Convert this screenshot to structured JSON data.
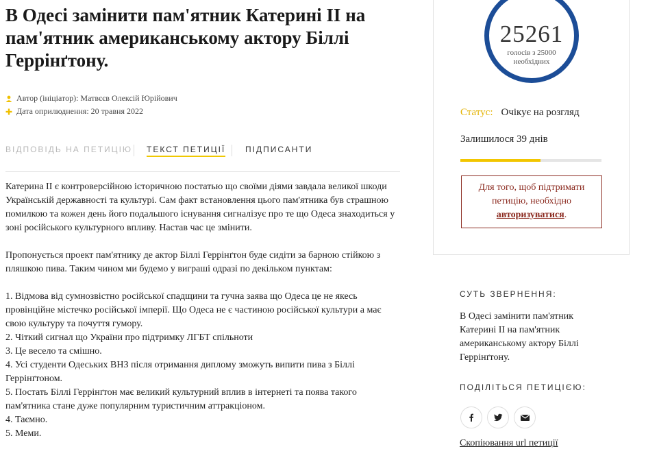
{
  "petition": {
    "title": "В Одесі замінити пам'ятник Катерині II на пам'ятник американському актору Біллі Геррінґтону.",
    "author": "Автор (ініціатор): Матвєєв Олексій Юрійович",
    "date": "Дата оприлюднення: 20 травня 2022",
    "body": "Катерина II є контроверсійною історичною постатью що своїми діями завдала великої шкоди Українській державності та культурі. Сам факт встановлення цього пам'ятника був страшною помилкою та кожен день його подальшого існування сигналізує про те що Одеса знаходиться у зоні російського культурного впливу. Настав час це змінити.\n\nПропонується проект пам'ятнику де актор Біллі Геррінґтон буде сидіти за барною стійкою з пляшкою пива. Таким чином ми будемо у виграші одразі по декільком пунктам:\n\n1. Відмова від сумнозвістно російської спадщини та гучна заява що Одеса це не якесь провінційне містечко російської імперії. Що Одеса не є частиною російської культури а має свою культуру та почуття гумору.\n2. Чіткий сигнал що України про підтримку ЛГБТ спільноти\n3. Це весело та смішно.\n4. Усі студенти Одеських ВНЗ після отримання диплому зможуть випити пива з Біллі Геррінґтоном.\n5. Постать Біллі Геррінґтон має великий культурний вплив в інтернеті та поява такого пам'ятника стане дуже популярним туристичним аттракціоном.\n4. Таємно.\n5. Меми."
  },
  "tabs": {
    "answer": "Відповідь на петицію",
    "text": "Текст петиції",
    "signers": "Підписанти"
  },
  "stats": {
    "votes": "25261",
    "votes_sub": "голосів з 25000 необхідних",
    "status_label": "Статус:",
    "status_value": "Очікує на розгляд",
    "days_left": "Залишилося 39 днів",
    "progress_fraction": 0.57,
    "auth_prefix": "Для того, щоб підтримати петицію, необхідно",
    "auth_link": "авторизуватися",
    "auth_suffix": "."
  },
  "sidebar": {
    "essence_heading": "Суть звернення:",
    "essence_text": "В Одесі замінити пам'ятник Катерині II на пам'ятник американському актору Біллі Геррінґтону.",
    "share_heading": "Поділіться петицією:",
    "share_icons": [
      "facebook-icon",
      "twitter-icon",
      "email-icon"
    ],
    "copy_link": "Скопіювання url петиції"
  },
  "colors": {
    "accent_yellow": "#f2c600",
    "circle_blue": "#1c4d97",
    "auth_red": "#8b2a1f"
  }
}
